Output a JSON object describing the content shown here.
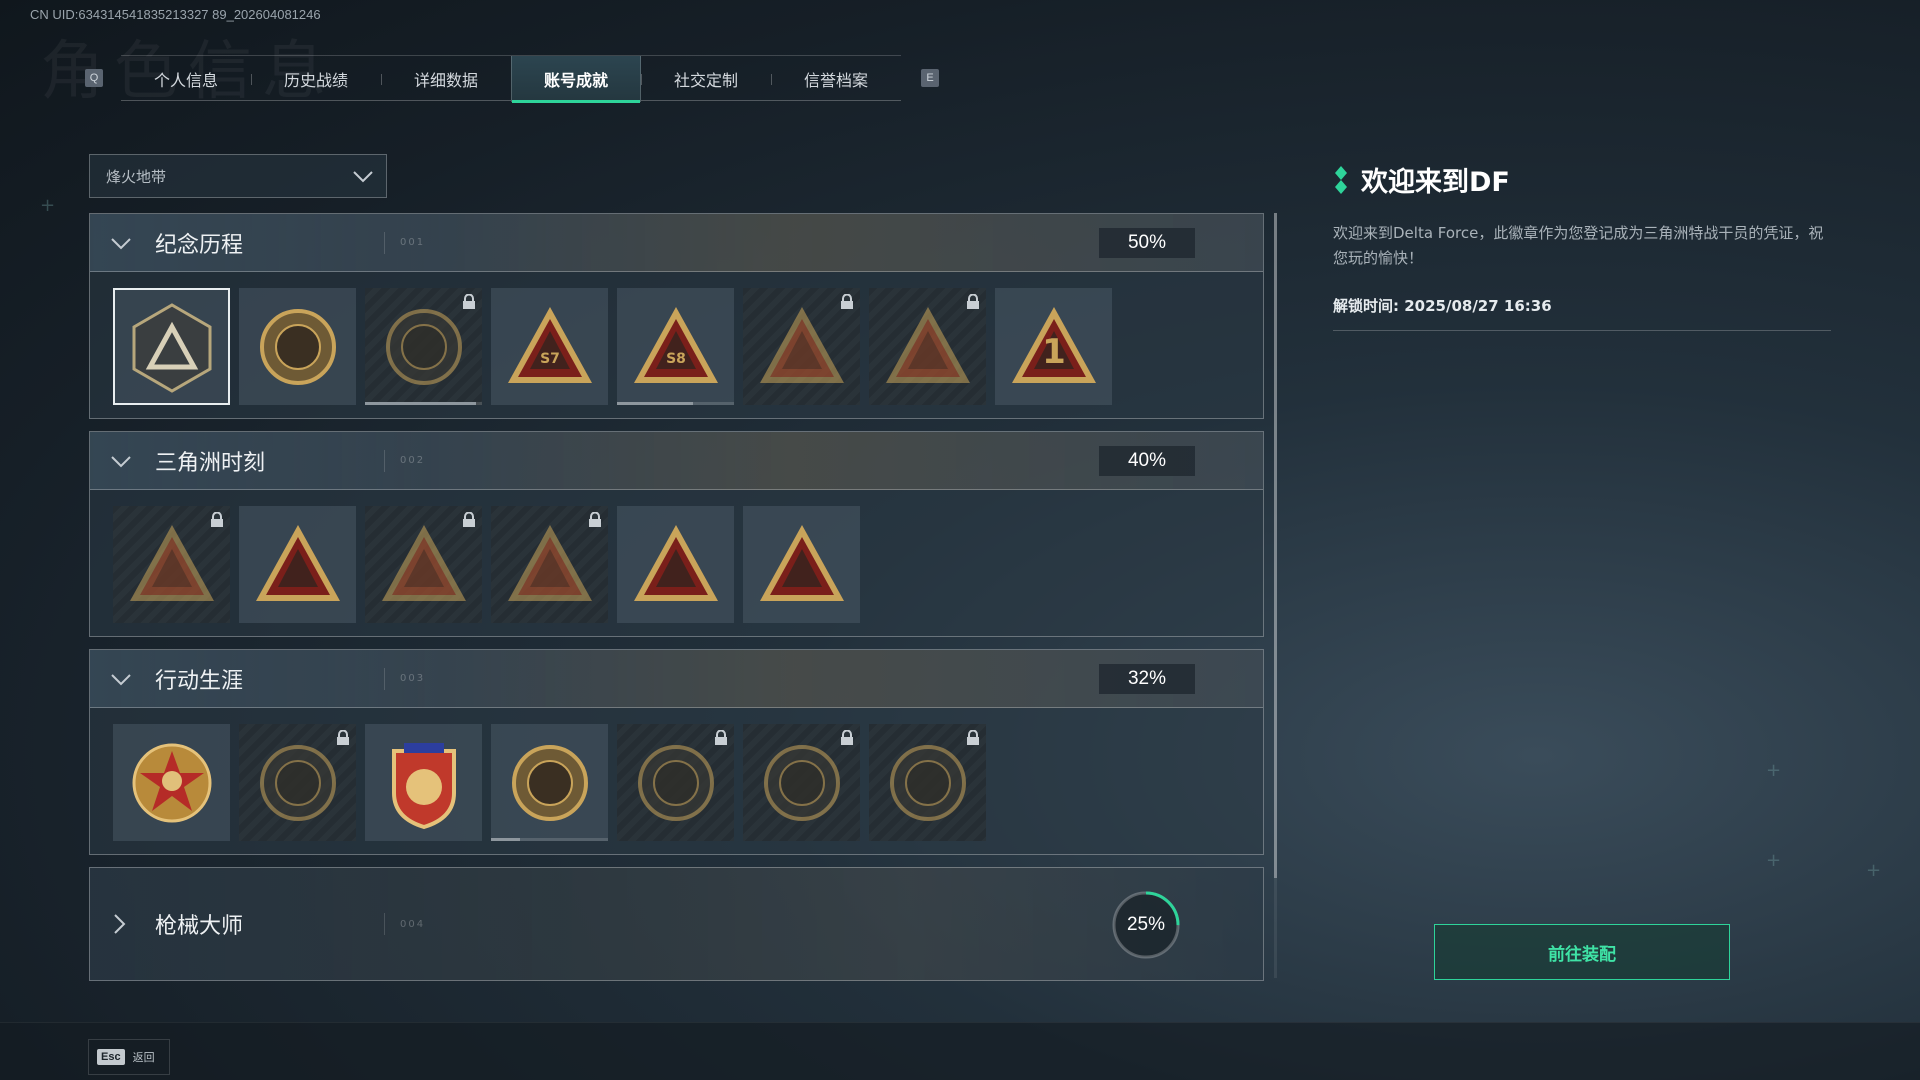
{
  "uid_text": "CN UID:634314541835213327 89_202604081246",
  "watermark": "角色信息",
  "tabs": {
    "prev_key": "Q",
    "next_key": "E",
    "items": [
      {
        "label": "个人信息"
      },
      {
        "label": "历史战绩"
      },
      {
        "label": "详细数据"
      },
      {
        "label": "账号成就",
        "active": true
      },
      {
        "label": "社交定制"
      },
      {
        "label": "信誉档案"
      }
    ]
  },
  "mode_select": {
    "value": "烽火地带"
  },
  "sections": [
    {
      "title": "纪念历程",
      "num": "001",
      "percent": "50%",
      "expanded": true,
      "badges": [
        {
          "icon": "delta-triangle-badge-icon",
          "locked": false,
          "selected": true
        },
        {
          "icon": "helicopter-shield-badge-icon",
          "locked": false
        },
        {
          "icon": "dark-crest-badge-icon",
          "locked": true,
          "progress": 0.95
        },
        {
          "icon": "season-57-triangle-badge-icon",
          "locked": false,
          "text": "S7"
        },
        {
          "icon": "season-58-triangle-badge-icon",
          "locked": false,
          "text": "S8",
          "progress": 0.65
        },
        {
          "icon": "hooded-operator-badge-icon",
          "locked": true
        },
        {
          "icon": "soldier-crossed-arms-badge-icon",
          "locked": true
        },
        {
          "icon": "number-one-triangle-badge-icon",
          "locked": false,
          "text": "1"
        }
      ]
    },
    {
      "title": "三角洲时刻",
      "num": "002",
      "percent": "40%",
      "expanded": true,
      "badges": [
        {
          "icon": "crate-triangle-badge-icon",
          "locked": true
        },
        {
          "icon": "skull-triangle-badge-icon",
          "locked": false
        },
        {
          "icon": "kneeling-operator-badge-icon",
          "locked": true
        },
        {
          "icon": "emblem-triangle-badge-icon",
          "locked": true
        },
        {
          "icon": "squad-triangle-badge-icon",
          "locked": false
        },
        {
          "icon": "rocket-triangle-badge-icon",
          "locked": false
        }
      ]
    },
    {
      "title": "行动生涯",
      "num": "003",
      "percent": "32%",
      "expanded": true,
      "badges": [
        {
          "icon": "star-medal-badge-icon",
          "locked": false
        },
        {
          "icon": "shield-wing-badge-icon",
          "locked": true
        },
        {
          "icon": "ribbon-shield-badge-icon",
          "locked": false
        },
        {
          "icon": "gem-shield-badge-icon",
          "locked": false,
          "progress": 0.25
        },
        {
          "icon": "globe-ring-badge-icon",
          "locked": true
        },
        {
          "icon": "skull-target-badge-icon",
          "locked": true
        },
        {
          "icon": "eye-ring-badge-icon",
          "locked": true
        }
      ]
    },
    {
      "title": "枪械大师",
      "num": "004",
      "percent": "25%",
      "expanded": false,
      "progress": 0.25
    }
  ],
  "detail": {
    "title": "欢迎来到DF",
    "description": "欢迎来到Delta Force，此徽章作为您登记成为三角洲特战干员的凭证，祝您玩的愉快！",
    "unlock_label": "解锁时间: 2025/08/27 16:36"
  },
  "equip_button": "前往装配",
  "footer": {
    "esc_key": "Esc",
    "back_label": "返回"
  },
  "colors": {
    "accent": "#2ed49a",
    "gold": "#c9a45a",
    "badge_red": "#7a1f1a"
  }
}
